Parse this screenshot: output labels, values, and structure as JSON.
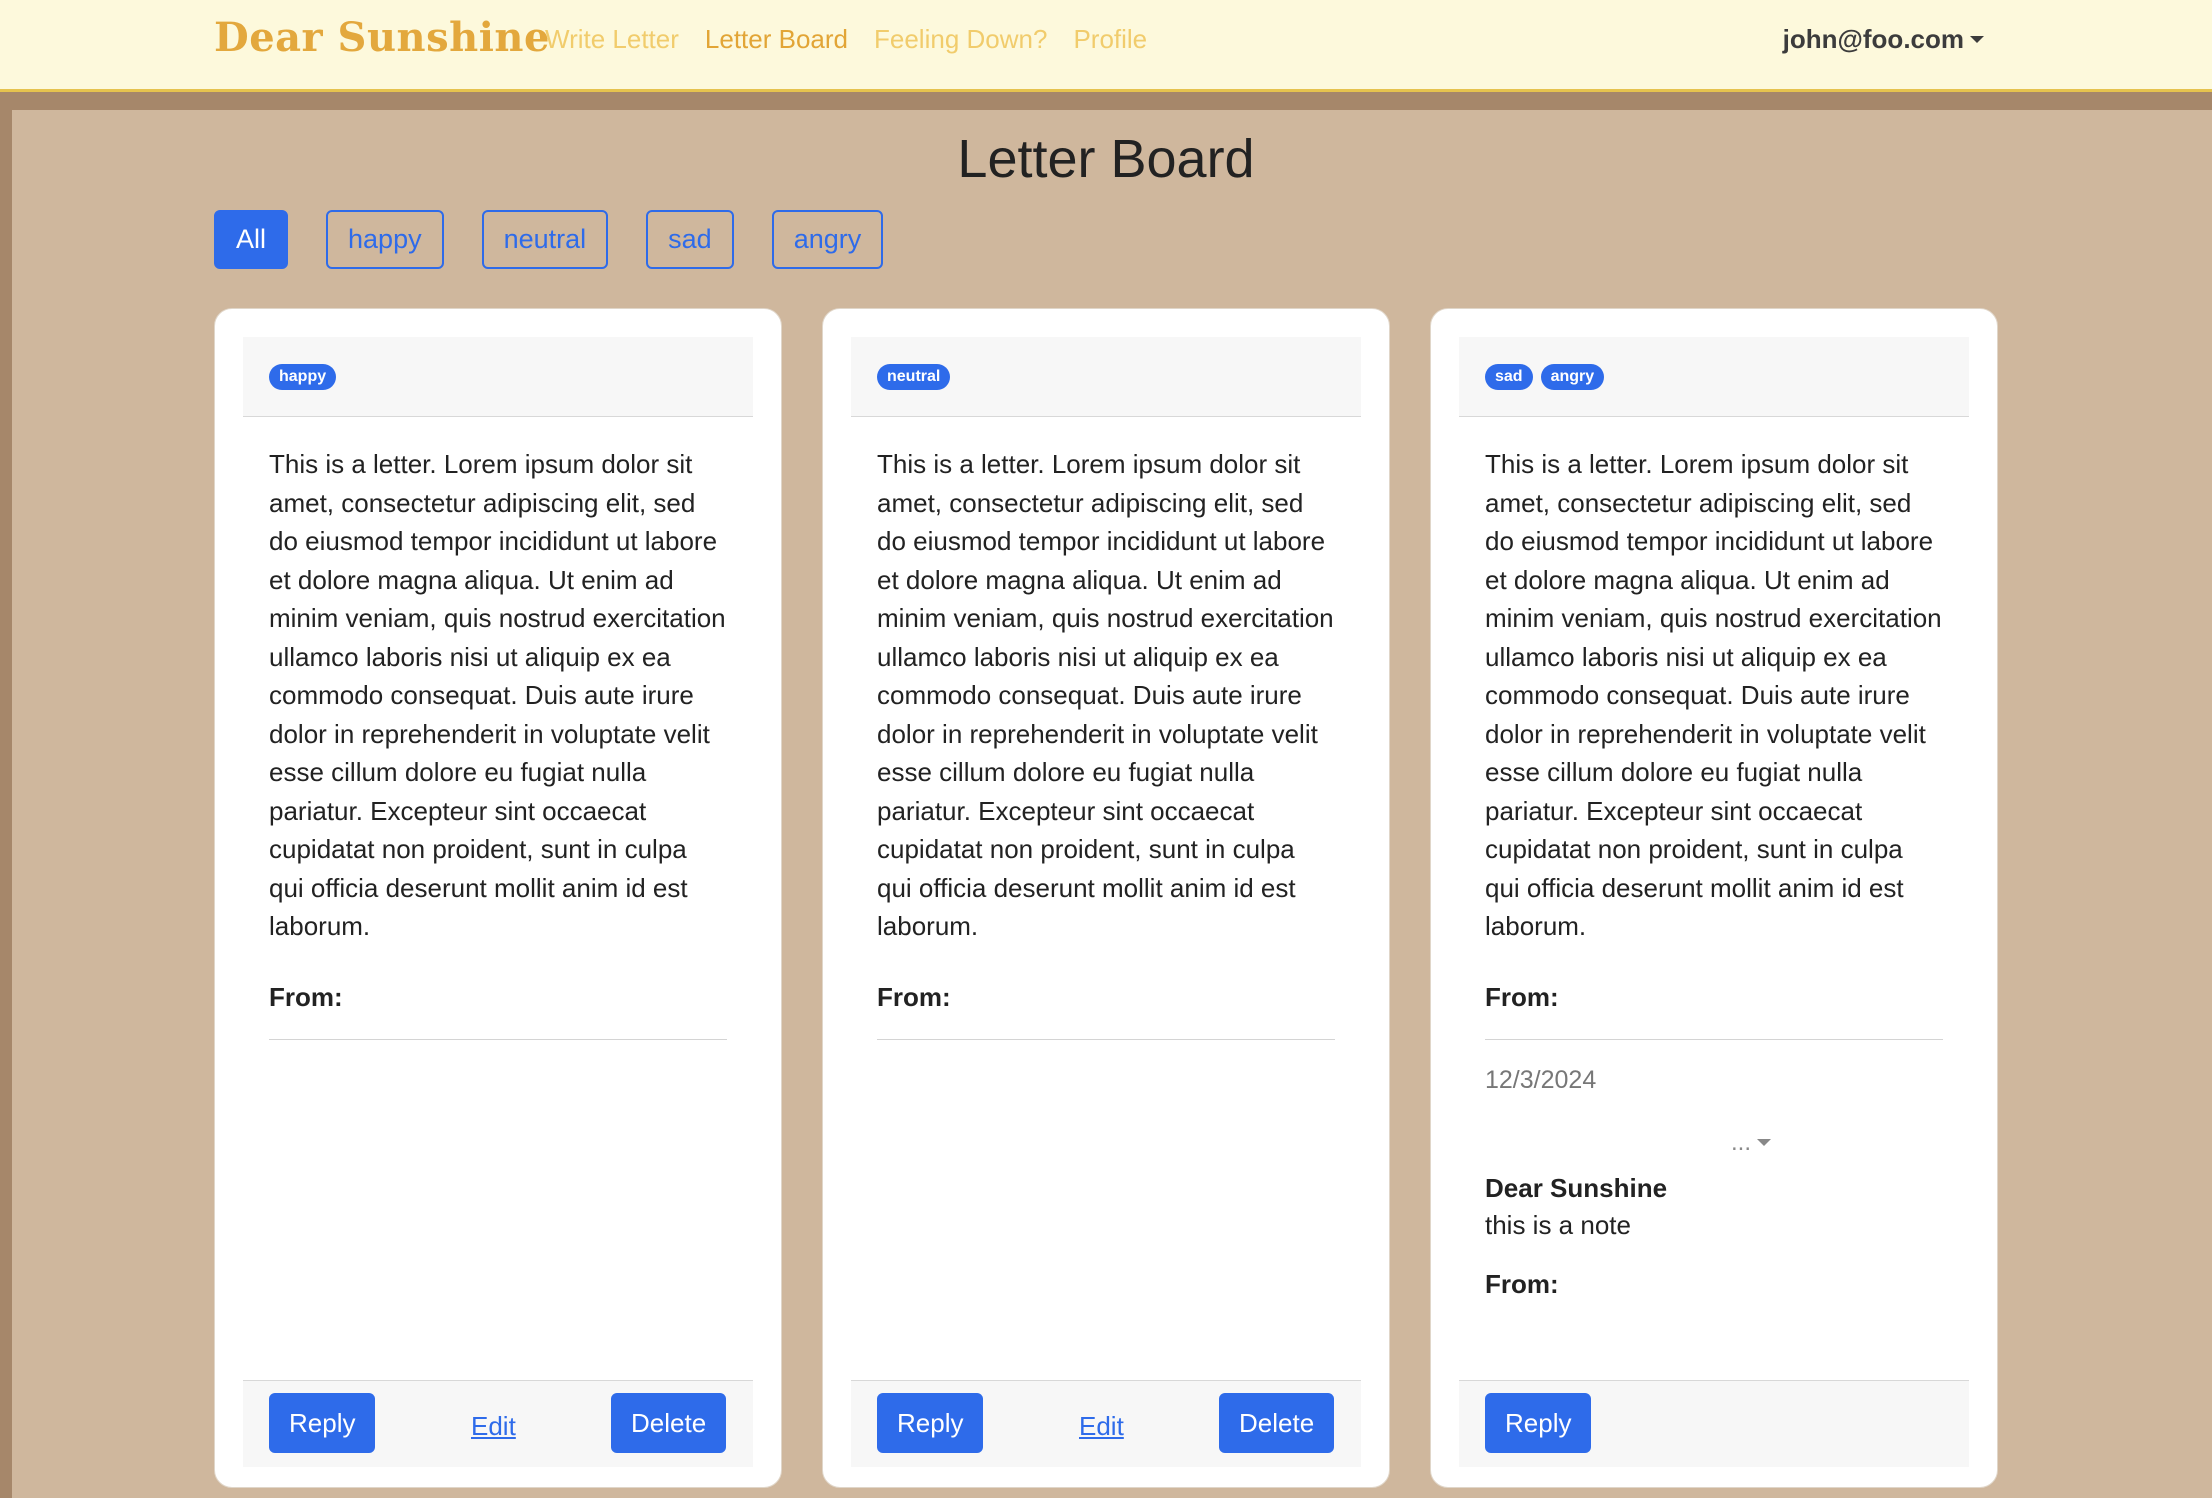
{
  "nav": {
    "brand": "Dear Sunshine",
    "links": [
      "Write Letter",
      "Letter Board",
      "Feeling Down?",
      "Profile"
    ],
    "active_link": "Letter Board",
    "user": "john@foo.com"
  },
  "page": {
    "title": "Letter Board"
  },
  "filters": [
    "All",
    "happy",
    "neutral",
    "sad",
    "angry"
  ],
  "cards": [
    {
      "tags": [
        "happy"
      ],
      "text": "This is a letter. Lorem ipsum dolor sit amet, consectetur adipiscing elit, sed do eiusmod tempor incididunt ut labore et dolore magna aliqua. Ut enim ad minim veniam, quis nostrud exercitation ullamco laboris nisi ut aliquip ex ea commodo consequat. Duis aute irure dolor in reprehenderit in voluptate velit esse cillum dolore eu fugiat nulla pariatur. Excepteur sint occaecat cupidatat non proident, sunt in culpa qui officia deserunt mollit anim id est laborum.",
      "from_label": "From:",
      "reply_label": "Reply",
      "edit_label": "Edit",
      "delete_label": "Delete"
    },
    {
      "tags": [
        "neutral"
      ],
      "text": "This is a letter. Lorem ipsum dolor sit amet, consectetur adipiscing elit, sed do eiusmod tempor incididunt ut labore et dolore magna aliqua. Ut enim ad minim veniam, quis nostrud exercitation ullamco laboris nisi ut aliquip ex ea commodo consequat. Duis aute irure dolor in reprehenderit in voluptate velit esse cillum dolore eu fugiat nulla pariatur. Excepteur sint occaecat cupidatat non proident, sunt in culpa qui officia deserunt mollit anim id est laborum.",
      "from_label": "From:",
      "reply_label": "Reply",
      "edit_label": "Edit",
      "delete_label": "Delete"
    },
    {
      "tags": [
        "sad",
        "angry"
      ],
      "text": "This is a letter. Lorem ipsum dolor sit amet, consectetur adipiscing elit, sed do eiusmod tempor incididunt ut labore et dolore magna aliqua. Ut enim ad minim veniam, quis nostrud exercitation ullamco laboris nisi ut aliquip ex ea commodo consequat. Duis aute irure dolor in reprehenderit in voluptate velit esse cillum dolore eu fugiat nulla pariatur. Excepteur sint occaecat cupidatat non proident, sunt in culpa qui officia deserunt mollit anim id est laborum.",
      "from_label": "From:",
      "reply_label": "Reply",
      "note": {
        "date": "12/3/2024",
        "menu": "...",
        "author": "Dear Sunshine",
        "body": "this is a note",
        "from_label": "From:"
      }
    }
  ],
  "colors": {
    "accent": "#2e6bea",
    "brand": "#e3a83d",
    "navbar_bg": "#fdf9dc",
    "board_bg": "#cfb79d"
  }
}
